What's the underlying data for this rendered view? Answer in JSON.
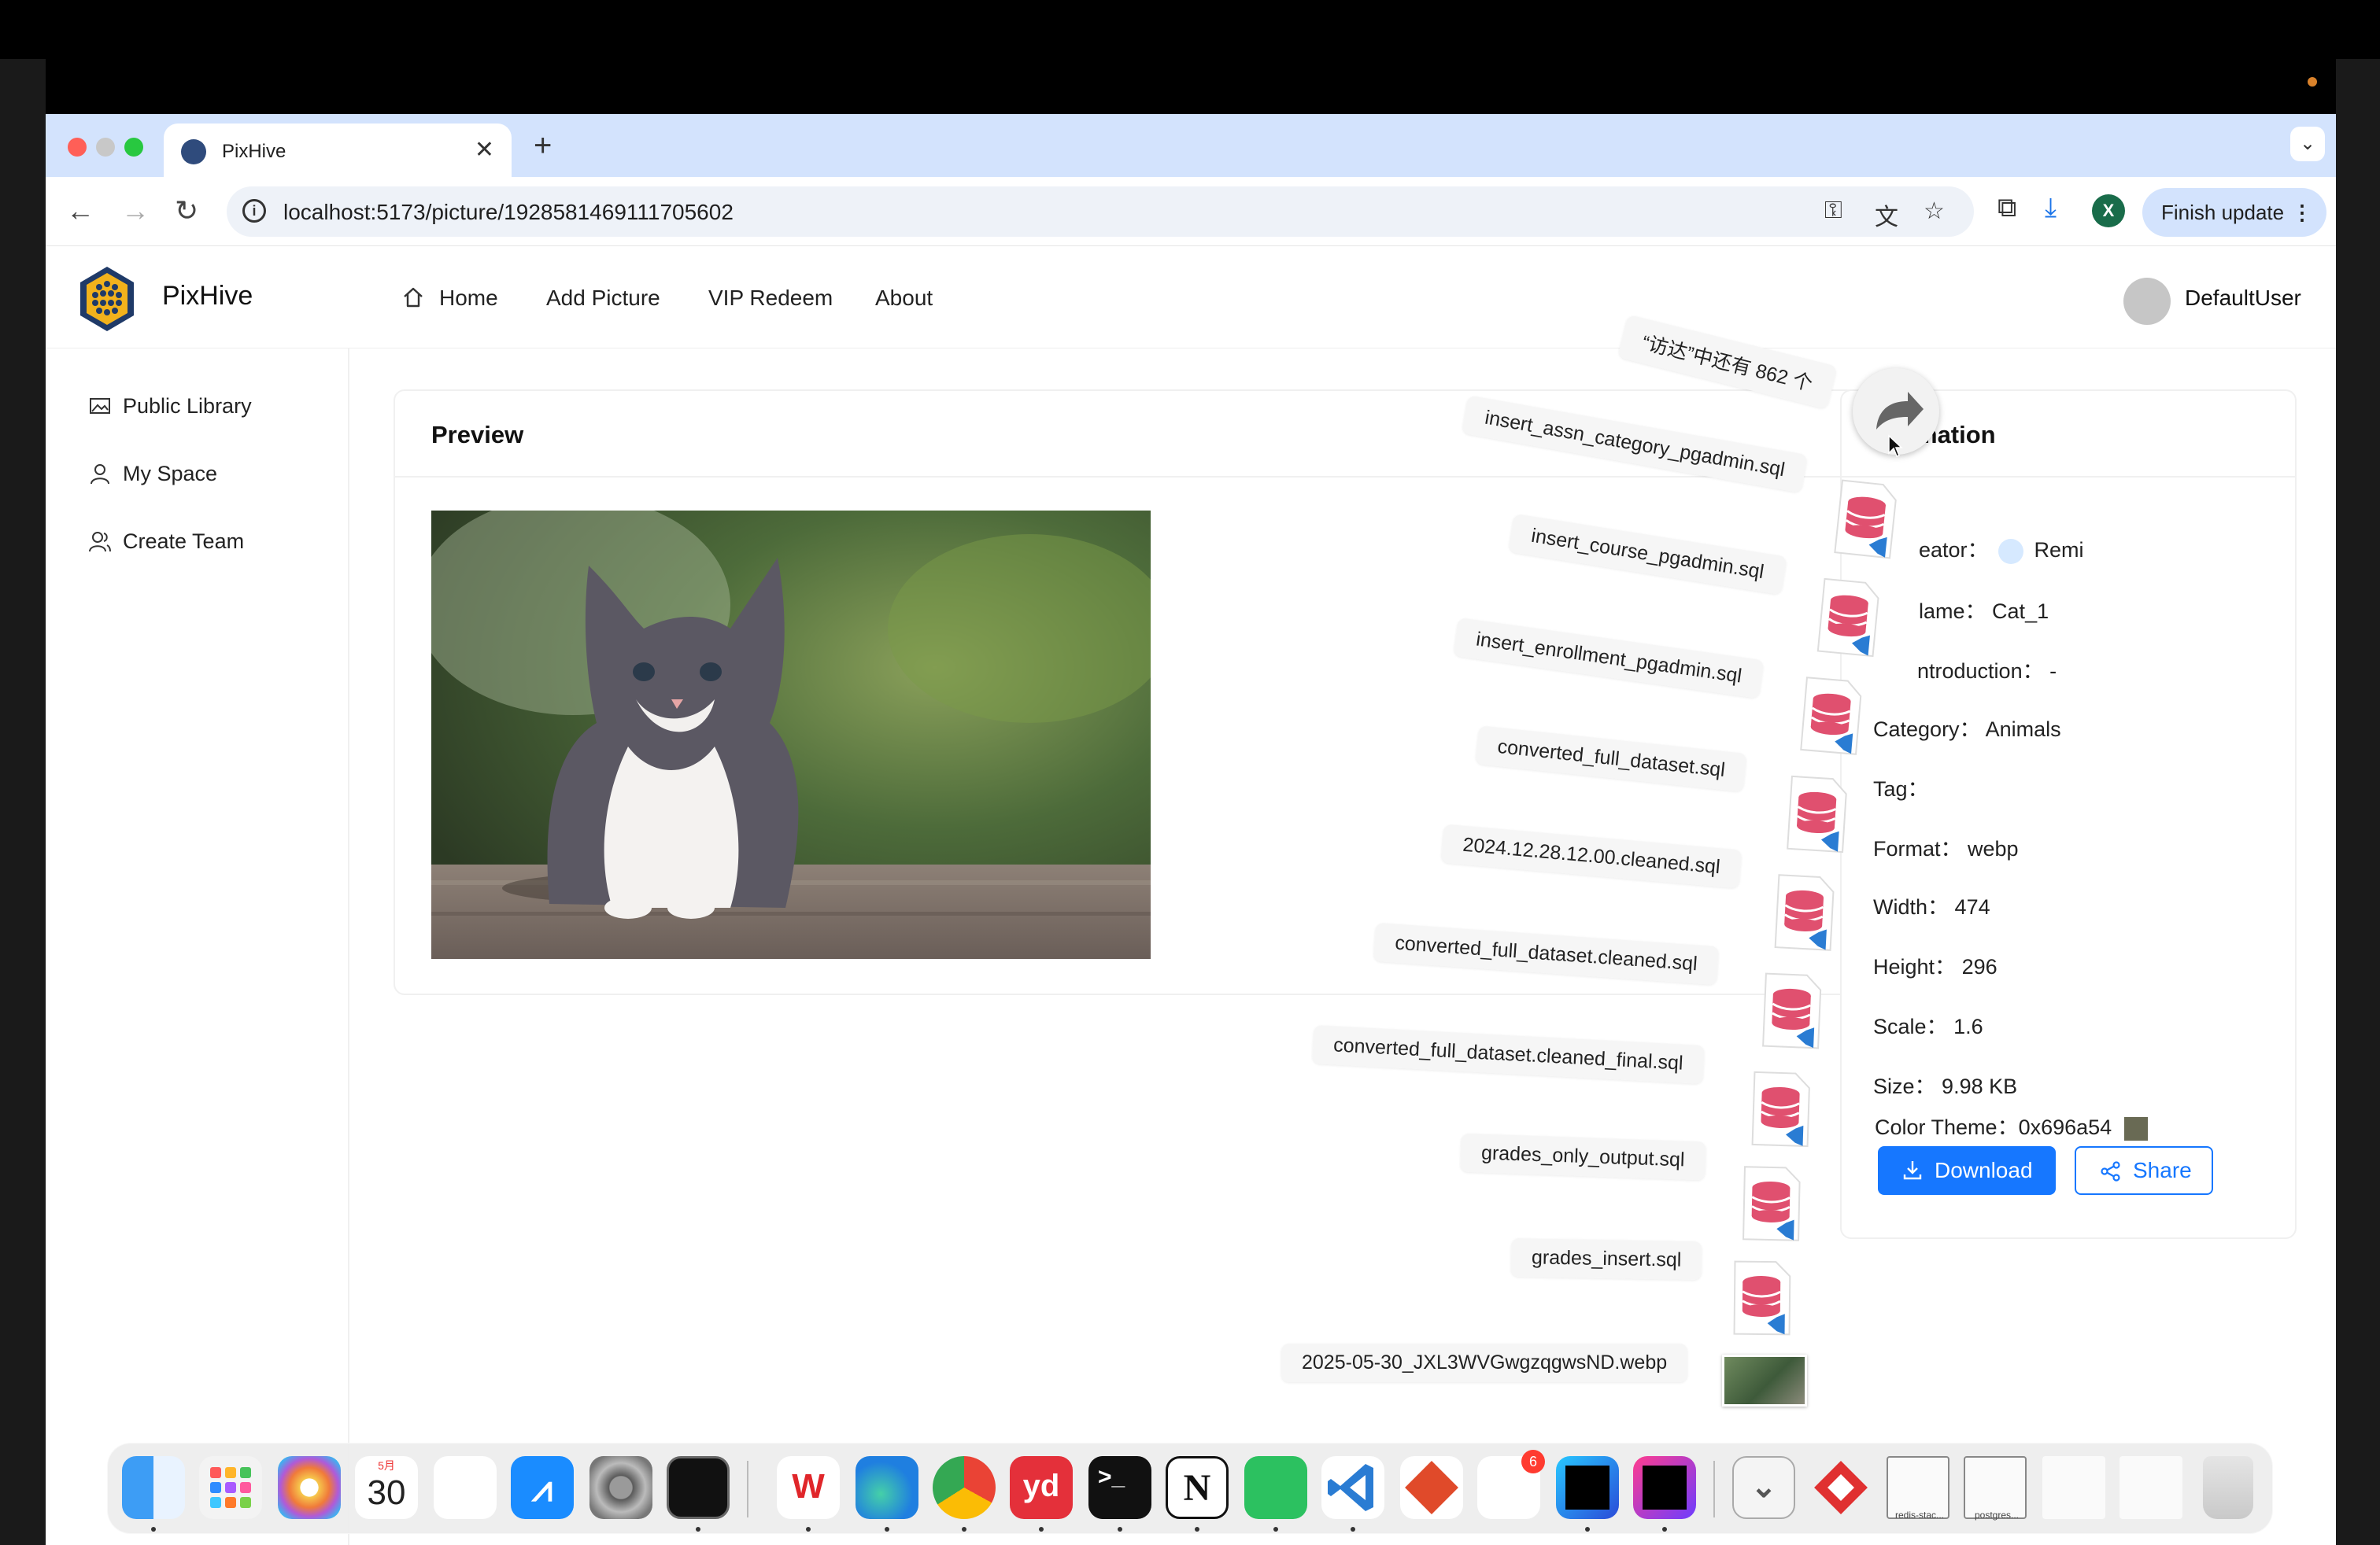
{
  "browser": {
    "tab_title": "PixHive",
    "url": "localhost:5173/picture/1928581469111705602",
    "finish_update": "Finish update",
    "profile_letter": "X"
  },
  "app": {
    "brand": "PixHive",
    "nav": [
      "Home",
      "Add Picture",
      "VIP Redeem",
      "About"
    ],
    "username": "DefaultUser",
    "sidebar": [
      "Public Library",
      "My Space",
      "Create Team"
    ]
  },
  "preview": {
    "title": "Preview"
  },
  "info": {
    "title_visible": "mation",
    "creator_label": "eator：",
    "creator_value": "Remi",
    "name_label": "lame：",
    "name_value": "Cat_1",
    "intro_label": "ntroduction：",
    "intro_value": "-",
    "category_label": "Category：",
    "category_value": "Animals",
    "tag_label": "Tag：",
    "format_label": "Format：",
    "format_value": "webp",
    "width_label": "Width：",
    "width_value": "474",
    "height_label": "Height：",
    "height_value": "296",
    "scale_label": "Scale：",
    "scale_value": "1.6",
    "size_label": "Size：",
    "size_value": "9.98 KB",
    "color_label": "Color Theme：",
    "color_value": "0x696a54",
    "color_hex": "#696a54",
    "download": "Download",
    "share": "Share"
  },
  "drag_stack": {
    "count_label": "“访达”中还有 862 个",
    "files": [
      "insert_assn_category_pgadmin.sql",
      "insert_course_pgadmin.sql",
      "insert_enrollment_pgadmin.sql",
      "converted_full_dataset.sql",
      "2024.12.28.12.00.cleaned.sql",
      "converted_full_dataset.cleaned.sql",
      "converted_full_dataset.cleaned_final.sql",
      "grades_only_output.sql",
      "grades_insert.sql",
      "2025-05-30_JXL3WVGwgzqgwsND.webp"
    ]
  },
  "dock": {
    "calendar_month": "5月",
    "calendar_day": "30",
    "badge_count": "6",
    "apps": [
      "finder-icon",
      "launchpad-icon",
      "photos-icon",
      "calendar-icon",
      "reminders-icon",
      "app-store-icon",
      "system-settings-icon",
      "activity-monitor-icon",
      "wps-icon",
      "edge-icon",
      "chrome-icon",
      "youdao-icon",
      "terminal-icon",
      "notion-icon",
      "wechat-icon",
      "vscode-icon",
      "git-icon",
      "installer-icon",
      "webstorm-icon",
      "intellij-icon",
      "downloads-stack-icon",
      "git-client-icon",
      "redis-window-icon",
      "postgres-window-icon",
      "doc-window-icon",
      "finder-window-icon",
      "trash-icon"
    ],
    "window_labels": [
      "redis-stac...",
      "postgres..."
    ]
  },
  "colors": {
    "accent": "#1677ff",
    "tabbar": "#d3e3fd",
    "sql_icon": "#e0506f"
  }
}
